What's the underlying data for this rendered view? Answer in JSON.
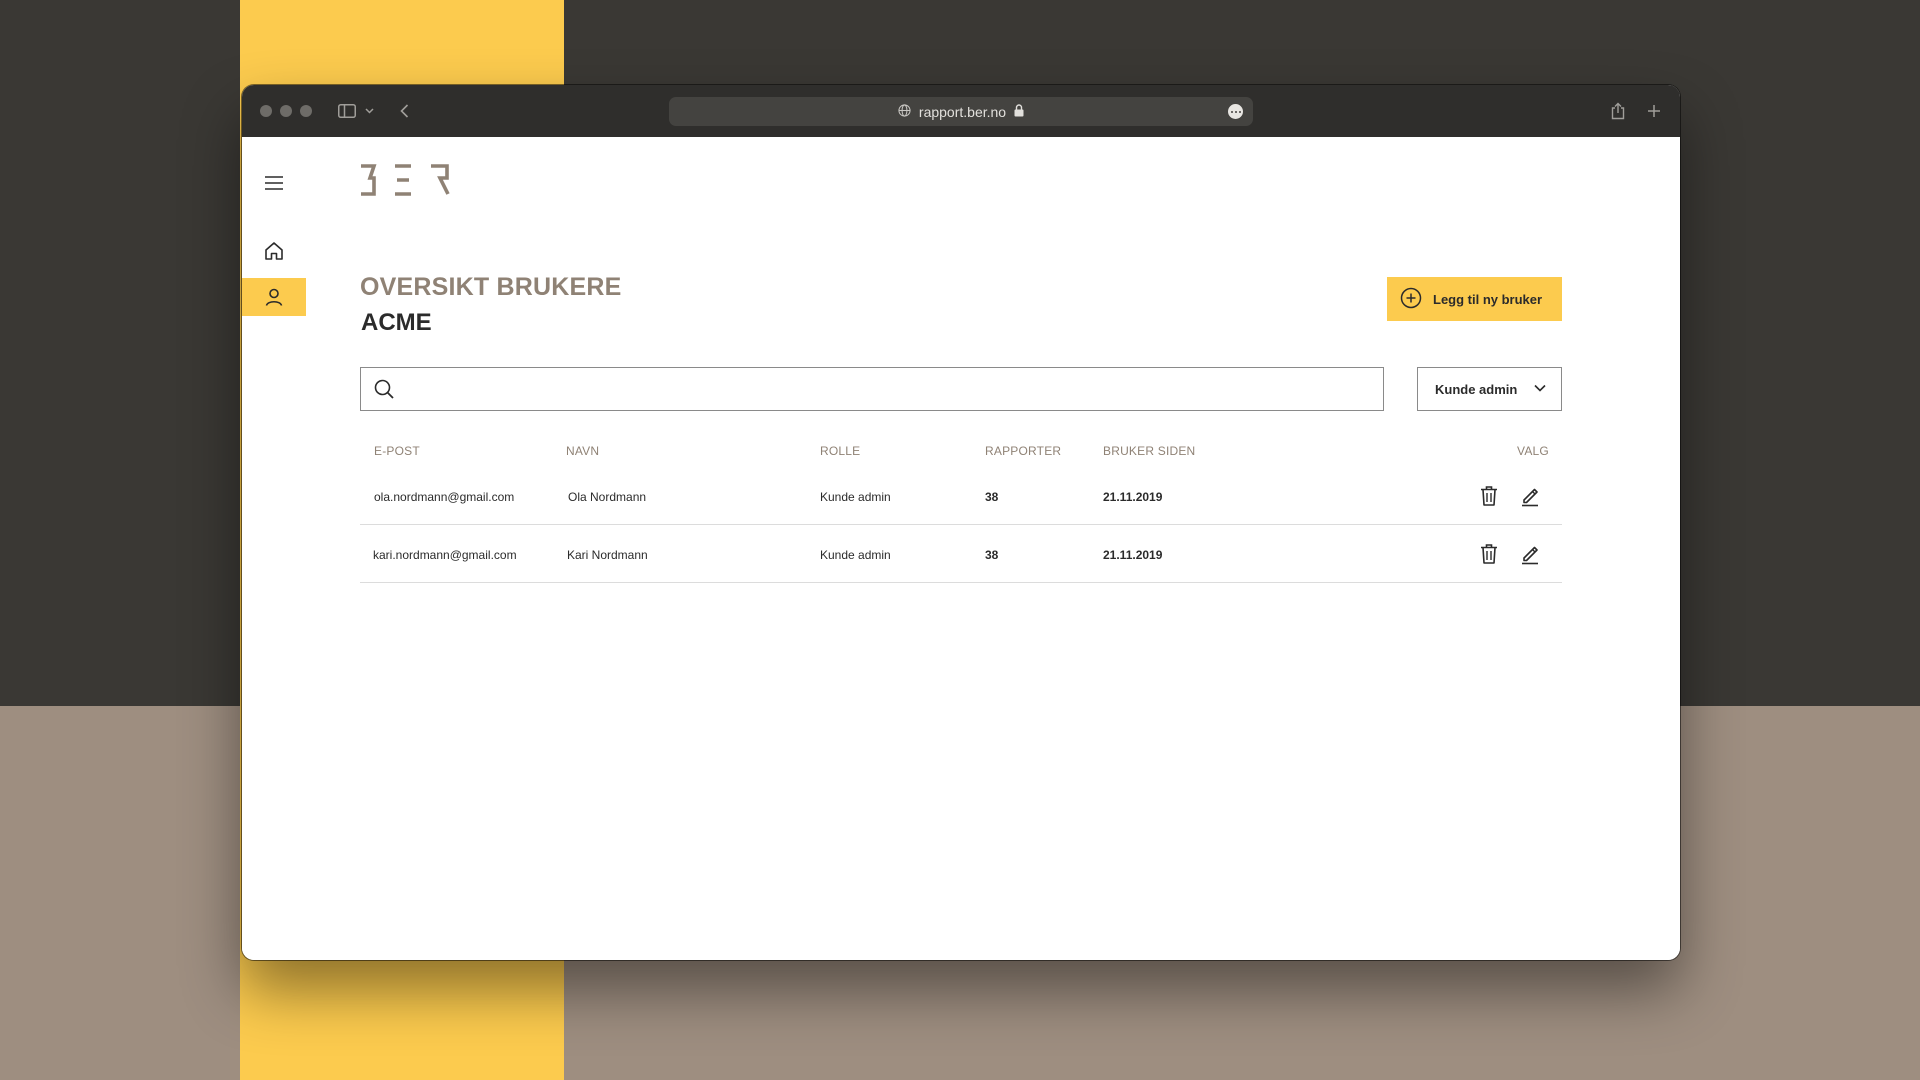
{
  "browser": {
    "url": "rapport.ber.no",
    "icons": [
      "sidebar-toggle-icon",
      "chevron-down-icon",
      "back-icon",
      "globe-icon",
      "lock-icon",
      "more-icon",
      "share-icon",
      "new-tab-icon"
    ]
  },
  "brand": {
    "logo_text": "BER",
    "accent_color": "#fccb4e",
    "muted_color": "#8f8275"
  },
  "nav": {
    "items": [
      "menu-icon",
      "home-icon",
      "user-icon"
    ],
    "active": "user-icon"
  },
  "page": {
    "title": "OVERSIKT BRUKERE",
    "company": "ACME",
    "add_button_label": "Legg til ny bruker"
  },
  "search": {
    "value": "",
    "placeholder": ""
  },
  "filter": {
    "selected": "Kunde admin"
  },
  "table": {
    "headers": {
      "email": "E-POST",
      "name": "NAVN",
      "role": "ROLLE",
      "reports": "RAPPORTER",
      "since": "BRUKER SIDEN",
      "actions": "VALG"
    },
    "rows": [
      {
        "email": "ola.nordmann@gmail.com",
        "name": "Ola Nordmann",
        "role": "Kunde admin",
        "reports": "38",
        "since": "21.11.2019"
      },
      {
        "email": "kari.nordmann@gmail.com",
        "name": "Kari Nordmann",
        "role": "Kunde admin",
        "reports": "38",
        "since": "21.11.2019"
      }
    ]
  }
}
